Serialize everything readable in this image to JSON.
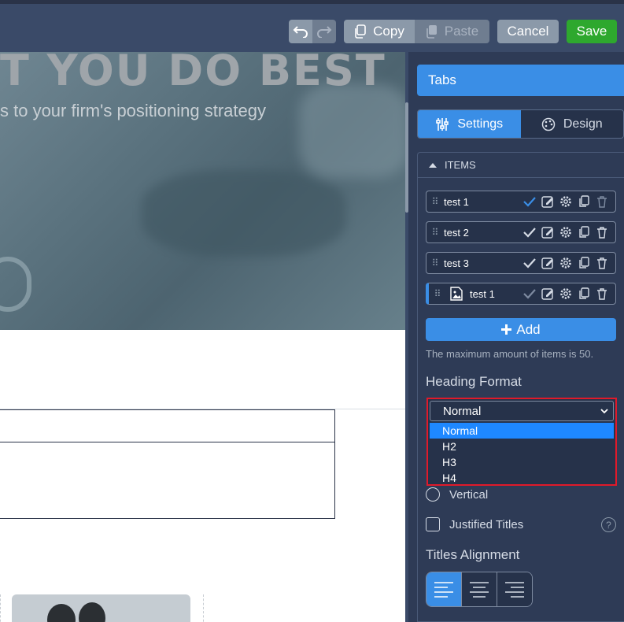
{
  "toolbar": {
    "copy_label": "Copy",
    "paste_label": "Paste",
    "cancel_label": "Cancel",
    "save_label": "Save"
  },
  "canvas": {
    "hero_title": "T YOU DO BEST",
    "hero_subtitle": "s to your firm's positioning strategy"
  },
  "panel": {
    "title": "Tabs",
    "tabs": [
      {
        "label": "Settings",
        "active": true
      },
      {
        "label": "Design",
        "active": false
      }
    ],
    "items_section": {
      "heading": "ITEMS",
      "items": [
        {
          "label": "test 1",
          "has_image_icon": false,
          "current": false
        },
        {
          "label": "test 2",
          "has_image_icon": false,
          "current": false
        },
        {
          "label": "test 3",
          "has_image_icon": false,
          "current": false
        },
        {
          "label": "test 1",
          "has_image_icon": true,
          "current": true
        }
      ],
      "add_label": "Add",
      "max_note": "The maximum amount of items is 50."
    },
    "heading_format": {
      "label": "Heading Format",
      "selected": "Normal",
      "options": [
        "Normal",
        "H2",
        "H3",
        "H4"
      ]
    },
    "orientation_option": "Vertical",
    "justified_titles_label": "Justified Titles",
    "help_icon_glyph": "?",
    "titles_alignment_label": "Titles Alignment",
    "alignment_options": [
      {
        "icon": "align-left-icon",
        "active": true
      },
      {
        "icon": "align-center-icon",
        "active": false
      },
      {
        "icon": "align-right-icon",
        "active": false
      }
    ]
  },
  "colors": {
    "toolbar_bg": "#3a4a68",
    "panel_bg": "#2e3b56",
    "accent": "#3a8ee6",
    "save_green": "#2ea82e",
    "highlight_red": "#e01a2a"
  }
}
